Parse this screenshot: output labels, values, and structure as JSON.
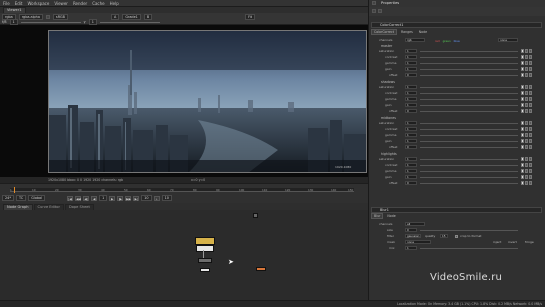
{
  "menubar": {
    "items": [
      "File",
      "Edit",
      "Workspace",
      "Viewer",
      "Render",
      "Cache",
      "Help"
    ]
  },
  "viewer": {
    "tab": "Viewer1",
    "toolbar": {
      "layer": "rgba",
      "channel": "rgba.alpha",
      "display": "sRGB",
      "input_a": "A",
      "input_b": "B",
      "compare": "Grade1",
      "zoom": "Fit",
      "gain_label": "f/8",
      "gain_value": "1",
      "gamma_label": "γ",
      "gamma_value": "1"
    },
    "info_text": "1920x1080  bbox: 0 0 1920 1920  channels: rgb",
    "coords": "x=0 y=0",
    "frame_range": "1920,1080"
  },
  "timeline": {
    "ticks": [
      "1",
      "10",
      "20",
      "30",
      "40",
      "50",
      "60",
      "70",
      "80",
      "90",
      "100",
      "110",
      "120",
      "130",
      "140",
      "150"
    ],
    "fps_label": "24*",
    "mode": "TC",
    "global": "Global",
    "current_frame": "1",
    "step": "10",
    "end": "10"
  },
  "graph_tabs": [
    "Node Graph",
    "Curve Editor",
    "Dope Sheet"
  ],
  "properties": {
    "title": "Properties",
    "node1": {
      "name": "ColorCorrect1",
      "tabs": [
        "ColorCorrect",
        "Ranges",
        "Node"
      ],
      "channels_label": "channels",
      "channels_value": "rgb",
      "channel_toggles": [
        "red",
        "green",
        "blue"
      ],
      "channels_extra": "none",
      "groups": [
        {
          "name": "master",
          "rows": [
            {
              "label": "saturation",
              "value": "1"
            },
            {
              "label": "contrast",
              "value": "1"
            },
            {
              "label": "gamma",
              "value": "1"
            },
            {
              "label": "gain",
              "value": "1"
            },
            {
              "label": "offset",
              "value": "0"
            }
          ]
        },
        {
          "name": "shadows",
          "rows": [
            {
              "label": "saturation",
              "value": "1"
            },
            {
              "label": "contrast",
              "value": "1"
            },
            {
              "label": "gamma",
              "value": "1"
            },
            {
              "label": "gain",
              "value": "1"
            },
            {
              "label": "offset",
              "value": "0"
            }
          ]
        },
        {
          "name": "midtones",
          "rows": [
            {
              "label": "saturation",
              "value": "1"
            },
            {
              "label": "contrast",
              "value": "1"
            },
            {
              "label": "gamma",
              "value": "1"
            },
            {
              "label": "gain",
              "value": "1"
            },
            {
              "label": "offset",
              "value": "0"
            }
          ]
        },
        {
          "name": "highlights",
          "rows": [
            {
              "label": "saturation",
              "value": "1"
            },
            {
              "label": "contrast",
              "value": "1"
            },
            {
              "label": "gamma",
              "value": "1"
            },
            {
              "label": "gain",
              "value": "1"
            },
            {
              "label": "offset",
              "value": "0"
            }
          ]
        }
      ]
    },
    "node2": {
      "name": "Blur1",
      "tabs": [
        "Blur",
        "Node"
      ],
      "rows": [
        {
          "label": "channels",
          "value": "all"
        },
        {
          "label": "size",
          "value": "0"
        },
        {
          "label": "filter",
          "value": "gaussian"
        },
        {
          "label": "quality",
          "value": "15"
        },
        {
          "label": "mask",
          "value": "none"
        },
        {
          "label": "mix",
          "value": "1"
        }
      ],
      "crop_label": "crop to format",
      "mask_extra": [
        "inject",
        "invert",
        "fringe"
      ]
    }
  },
  "watermark": "VideoSmile.ru",
  "status": "Localization Mode: On  Memory: 3.4 GB (1.1%)  CPU: 1.8% Disk: 0.2 MB/s  Network: 0.0 MB/s",
  "colors": {
    "accent": "#e08a2a",
    "node_yellow": "#d6b24a",
    "node_white": "#e6e6e6",
    "node_orange": "#d9773a"
  }
}
